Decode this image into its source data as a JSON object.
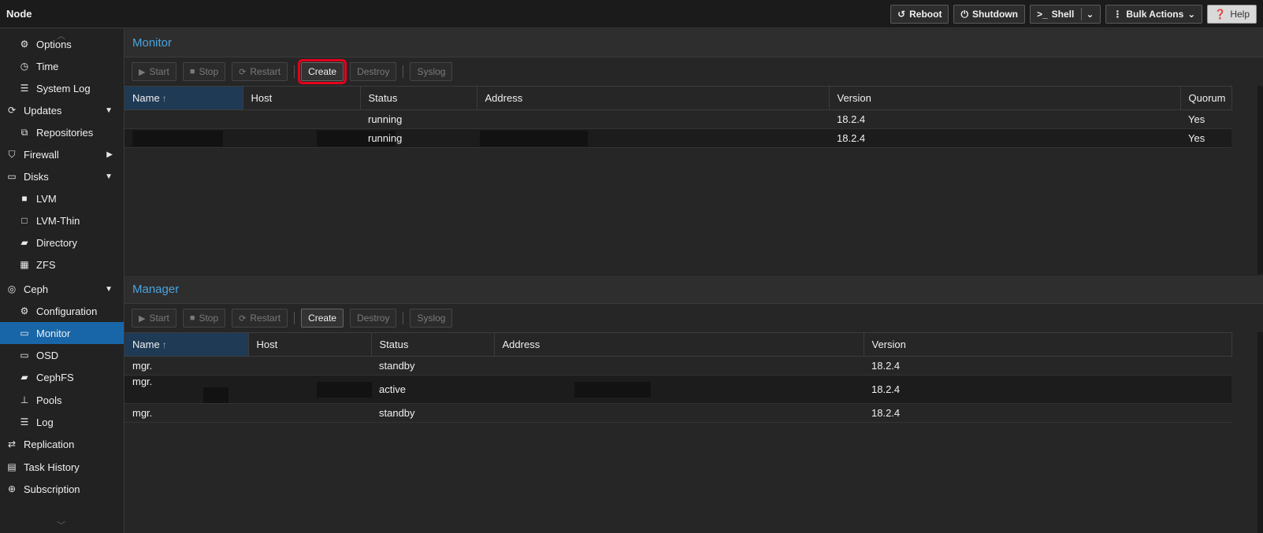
{
  "topbar": {
    "title": "Node",
    "buttons": {
      "reboot": "Reboot",
      "shutdown": "Shutdown",
      "shell": "Shell",
      "bulk_actions": "Bulk Actions",
      "help": "Help"
    }
  },
  "sidebar": {
    "selected": "Monitor",
    "items": [
      {
        "label": "Options",
        "icon": "gear-icon"
      },
      {
        "label": "Time",
        "icon": "clock-icon"
      },
      {
        "label": "System Log",
        "icon": "list-icon"
      },
      {
        "label": "Updates",
        "icon": "refresh-icon"
      },
      {
        "label": "Repositories",
        "icon": "copy-icon"
      },
      {
        "label": "Firewall",
        "icon": "shield-icon"
      },
      {
        "label": "Disks",
        "icon": "drive-icon"
      },
      {
        "label": "LVM",
        "icon": "square-icon"
      },
      {
        "label": "LVM-Thin",
        "icon": "square-outline-icon"
      },
      {
        "label": "Directory",
        "icon": "folder-icon"
      },
      {
        "label": "ZFS",
        "icon": "grid-icon"
      },
      {
        "label": "Ceph",
        "icon": "ceph-icon"
      },
      {
        "label": "Configuration",
        "icon": "gear-icon"
      },
      {
        "label": "Monitor",
        "icon": "desktop-icon"
      },
      {
        "label": "OSD",
        "icon": "drive-icon"
      },
      {
        "label": "CephFS",
        "icon": "folder-icon"
      },
      {
        "label": "Pools",
        "icon": "sitemap-icon"
      },
      {
        "label": "Log",
        "icon": "list-icon"
      },
      {
        "label": "Replication",
        "icon": "retweet-icon"
      },
      {
        "label": "Task History",
        "icon": "list-alt-icon"
      },
      {
        "label": "Subscription",
        "icon": "support-icon"
      }
    ]
  },
  "monitor": {
    "title": "Monitor",
    "toolbar": {
      "start": "Start",
      "stop": "Stop",
      "restart": "Restart",
      "create": "Create",
      "destroy": "Destroy",
      "syslog": "Syslog"
    },
    "columns": [
      "Name",
      "Host",
      "Status",
      "Address",
      "Version",
      "Quorum"
    ],
    "rows": [
      {
        "name": "",
        "host": "",
        "status": "running",
        "address": "",
        "version": "18.2.4",
        "quorum": "Yes"
      },
      {
        "name": "",
        "host": "",
        "status": "running",
        "address": "",
        "version": "18.2.4",
        "quorum": "Yes"
      }
    ]
  },
  "manager": {
    "title": "Manager",
    "toolbar": {
      "start": "Start",
      "stop": "Stop",
      "restart": "Restart",
      "create": "Create",
      "destroy": "Destroy",
      "syslog": "Syslog"
    },
    "columns": [
      "Name",
      "Host",
      "Status",
      "Address",
      "Version"
    ],
    "rows": [
      {
        "name": "mgr.",
        "host": "",
        "status": "standby",
        "address": "",
        "version": "18.2.4"
      },
      {
        "name": "mgr.",
        "host": "",
        "status": "active",
        "address": "",
        "version": "18.2.4"
      },
      {
        "name": "mgr.",
        "host": "",
        "status": "standby",
        "address": "",
        "version": "18.2.4"
      }
    ]
  },
  "colors": {
    "accent": "#4aa3df",
    "selected": "#1866a8",
    "highlight_outline": "#e3001b"
  }
}
